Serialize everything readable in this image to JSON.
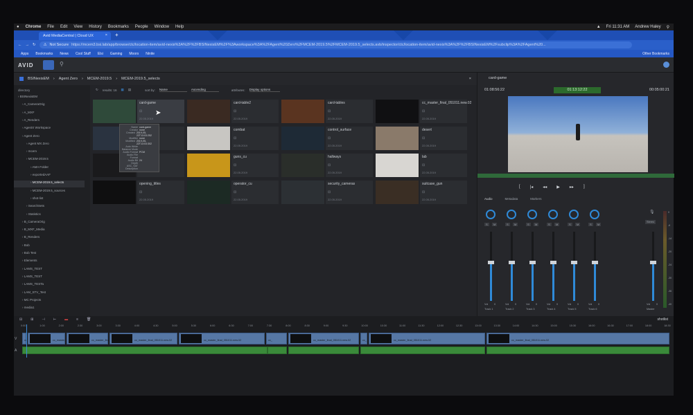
{
  "menubar": {
    "app": "Chrome",
    "items": [
      "File",
      "Edit",
      "View",
      "History",
      "Bookmarks",
      "People",
      "Window",
      "Help"
    ],
    "clock": "Fri 11:31 AM",
    "user": "Andrew Haley"
  },
  "browser": {
    "tab_title": "Avid MediaCentral | Cloud UX",
    "security": "Not Secure",
    "url": "https://mcem3.bsi.lab/app/browse/ctc/location-item/avid-nexis%3A%2F%2FBSINexisEM%2F%3Aworkspace%3A%2FAgent%20Zero%2FMCEM-2019.5%2FMCEM-2019.5_selects.avb/inspector/ctc/location-item/avid-nexis%3A%2F%2FBSINexisEM%2Fsubclip%3A%2FAgent%20...",
    "bookmarks": [
      "Apps",
      "Bookmarks",
      "News",
      "Cool Stuff",
      "Elsi",
      "Gaming",
      "Moors",
      "Ninite"
    ],
    "other_bookmarks": "Other Bookmarks"
  },
  "app": {
    "logo": "AVID",
    "breadcrumb": [
      "BSINexisEM",
      "Agent Zero",
      "MCEM-2019.5",
      "MCEM-2019.5_selects"
    ],
    "results": "results: 16",
    "sort_label": "sort by:",
    "sort_value": "Name",
    "sort_order": "Ascending",
    "attributes_label": "attributes:",
    "display_options": "Display options"
  },
  "tree": {
    "header": "directory",
    "items": [
      {
        "label": "BSINexisEM",
        "indent": 0
      },
      {
        "label": "A_CameraOrig",
        "indent": 1
      },
      {
        "label": "A_MXF",
        "indent": 1
      },
      {
        "label": "A_Renders",
        "indent": 1
      },
      {
        "label": "AgentX Workspace",
        "indent": 1
      },
      {
        "label": "Agent Zero",
        "indent": 1
      },
      {
        "label": "Agent MX Zero",
        "indent": 2
      },
      {
        "label": "mcem",
        "indent": 2
      },
      {
        "label": "MCEM-2019.5",
        "indent": 2
      },
      {
        "label": "AMA Folder",
        "indent": 3
      },
      {
        "label": "exportedAAF",
        "indent": 3
      },
      {
        "label": "MCEM-2019.5_selects",
        "indent": 3,
        "selected": true
      },
      {
        "label": "MCEM-2019.5_sources",
        "indent": 3
      },
      {
        "label": "shot-list",
        "indent": 3
      },
      {
        "label": "SearchSets",
        "indent": 2
      },
      {
        "label": "Statistics",
        "indent": 2
      },
      {
        "label": "B_CameraOrig",
        "indent": 1
      },
      {
        "label": "B_MXF_Media",
        "indent": 1
      },
      {
        "label": "B_Renders",
        "indent": 1
      },
      {
        "label": "Bob",
        "indent": 1
      },
      {
        "label": "Bob Test",
        "indent": 1
      },
      {
        "label": "Elements",
        "indent": 1
      },
      {
        "label": "LAMS_TEST",
        "indent": 1
      },
      {
        "label": "LAMS_TEST",
        "indent": 1
      },
      {
        "label": "LAMS_TESTa",
        "indent": 1
      },
      {
        "label": "LAM_STV_Test",
        "indent": 1
      },
      {
        "label": "MC Projects",
        "indent": 1
      },
      {
        "label": "media1",
        "indent": 1
      }
    ]
  },
  "clips": [
    {
      "name": "card-game",
      "date": "22.05.2019",
      "thumb": "#2f4a3a",
      "selected": true
    },
    {
      "name": "card-table2",
      "date": "22.05.2019",
      "thumb": "#3a2a22"
    },
    {
      "name": "card-tables",
      "date": "22.05.2019",
      "thumb": "#5a3420"
    },
    {
      "name": "cc_master_final_051011.new.02",
      "date": "22.05.2019",
      "thumb": "#101012"
    },
    {
      "name": "",
      "date": "",
      "thumb": "#2a3340"
    },
    {
      "name": "combat",
      "date": "22.05.2019",
      "thumb": "#c8c6c2"
    },
    {
      "name": "control_surface",
      "date": "22.05.2019",
      "thumb": "#1e2a36"
    },
    {
      "name": "desert",
      "date": "22.05.2019",
      "thumb": "#8a7a6a"
    },
    {
      "name": "",
      "date": "",
      "thumb": "#1a1a1c"
    },
    {
      "name": "guns_cu",
      "date": "22.05.2019",
      "thumb": "#c8961a"
    },
    {
      "name": "hallways",
      "date": "22.05.2019",
      "thumb": "#2a2e2a"
    },
    {
      "name": "lab",
      "date": "22.05.2019",
      "thumb": "#d8d6d2"
    },
    {
      "name": "opening_titles",
      "date": "22.05.2019",
      "thumb": "#0f0f10"
    },
    {
      "name": "operator_cu",
      "date": "22.05.2019",
      "thumb": "#1c2a24"
    },
    {
      "name": "security_cameras",
      "date": "22.05.2019",
      "thumb": "#2c3034"
    },
    {
      "name": "suitcase_gun",
      "date": "22.05.2019",
      "thumb": "#3a2e24"
    }
  ],
  "tooltip": {
    "rows": [
      [
        "Name",
        "card-game"
      ],
      [
        "Creator",
        "none"
      ],
      [
        "Created",
        "2019-05-22T13:03:252"
      ],
      [
        "Modifier",
        "none"
      ],
      [
        "Modified",
        "2019-05-22T13:03:302"
      ],
      [
        "Auto White Balance Mode",
        ""
      ],
      [
        "Audio Format",
        "PCM"
      ],
      [
        "Audio File Format",
        ""
      ],
      [
        "Audio Bit Depth",
        "24"
      ],
      [
        "ASC_SAT",
        ""
      ],
      [
        "Description",
        ""
      ]
    ]
  },
  "inspector": {
    "title": "card-game",
    "tc_in": "01:08:56:22",
    "tc_center": "01:13:12:22",
    "tc_out": "00:05:00:21",
    "tabs": [
      "Audio",
      "Metadata",
      "Markers"
    ],
    "stereo": "Stereo",
    "channels": [
      {
        "vol": "Vol",
        "val": "0",
        "name": "Track 1",
        "level": 0.55
      },
      {
        "vol": "Vol",
        "val": "0",
        "name": "Track 2",
        "level": 0.55
      },
      {
        "vol": "Vol",
        "val": "0",
        "name": "Track 3",
        "level": 0.55
      },
      {
        "vol": "Vol",
        "val": "0",
        "name": "Track 4",
        "level": 0.55
      },
      {
        "vol": "Vol",
        "val": "0",
        "name": "Track 5",
        "level": 0.55
      },
      {
        "vol": "Vol",
        "val": "0",
        "name": "Track 6",
        "level": 0.55
      }
    ],
    "master": {
      "vol": "Vol",
      "val": "0",
      "name": "Master",
      "level": 0.55
    },
    "meter_scale": [
      "0",
      "-6",
      "-14",
      "-20",
      "-24",
      "-30",
      "-36",
      "-40"
    ]
  },
  "timeline": {
    "label": "shotlist",
    "ruler": [
      "0:00",
      "1:00",
      "2:00",
      "2:30",
      "3:00",
      "3:30",
      "4:00",
      "4:30",
      "5:00",
      "5:30",
      "6:00",
      "6:30",
      "7:00",
      "7:30",
      "8:00",
      "8:30",
      "9:00",
      "9:30",
      "10:00",
      "10:30",
      "11:00",
      "11:30",
      "12:00",
      "12:30",
      "13:00",
      "13:30",
      "14:00",
      "14:30",
      "15:00",
      "15:30",
      "16:00",
      "16:30",
      "17:00",
      "18:00",
      "18:30"
    ],
    "track_v": "V",
    "track_a": "A",
    "clip_label": "cc_master_final_051011.new.02",
    "clip_short": "cc_"
  },
  "colors": {
    "accent": "#3a6fd8",
    "audio_clip": "#3a8a3a",
    "video_clip": "#5677a4",
    "fader": "#2f8ad8"
  }
}
